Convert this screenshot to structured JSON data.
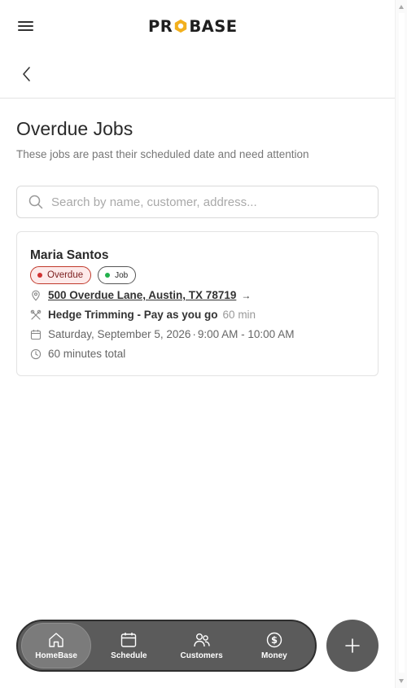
{
  "header": {
    "logo_left": "PR",
    "logo_right": "BASE",
    "brand_color": "#f2b01e"
  },
  "page": {
    "title": "Overdue Jobs",
    "subtitle": "These jobs are past their scheduled date and need attention"
  },
  "search": {
    "placeholder": "Search by name, customer, address...",
    "value": ""
  },
  "jobs": [
    {
      "customer": "Maria Santos",
      "status_badge": "Overdue",
      "type_badge": "Job",
      "address": "500 Overdue Lane, Austin, TX 78719",
      "address_arrow": "→",
      "service": "Hedge Trimming - Pay as you go",
      "service_duration": "60 min",
      "date": "Saturday, September 5, 2026",
      "time_separator": "·",
      "time_range": "9:00 AM - 10:00 AM",
      "total": "60 minutes total"
    }
  ],
  "bottom_nav": {
    "items": [
      {
        "label": "HomeBase",
        "icon": "home-icon",
        "active": true
      },
      {
        "label": "Schedule",
        "icon": "calendar-icon",
        "active": false
      },
      {
        "label": "Customers",
        "icon": "users-icon",
        "active": false
      },
      {
        "label": "Money",
        "icon": "dollar-icon",
        "active": false
      }
    ],
    "fab_icon": "plus-icon"
  },
  "colors": {
    "overdue_badge_border": "#c0392b",
    "overdue_dot": "#d03232",
    "job_dot": "#22b14c",
    "nav_background": "#5b5b5b"
  }
}
